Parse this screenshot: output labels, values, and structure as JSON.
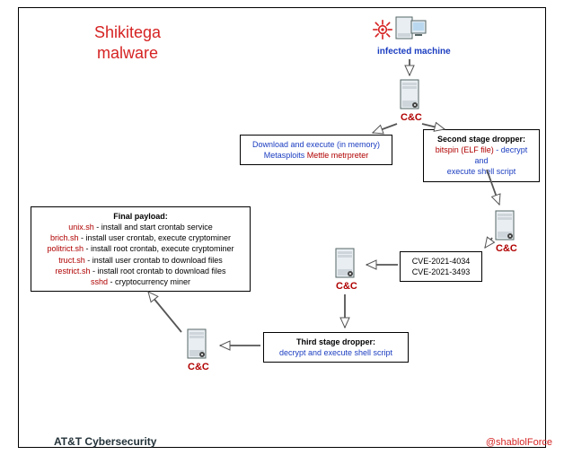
{
  "title_line1": "Shikitega",
  "title_line2": "malware",
  "footer_left": "AT&T Cybersecurity",
  "footer_right": "@shablolForce",
  "labels": {
    "infected": "infected machine",
    "cc": "C&C"
  },
  "boxes": {
    "mettle": {
      "line1": "Download and execute (in memory)",
      "line2a": "Metasploits ",
      "line2b": "Mettle metrpreter"
    },
    "second_stage": {
      "title": "Second stage dropper:",
      "line1a": "bitspin (ELF file)",
      "line1b": " - decrypt and",
      "line2": "execute shell script"
    },
    "cves": {
      "line1": "CVE-2021-4034",
      "line2": "CVE-2021-3493"
    },
    "third_stage": {
      "title": "Third stage dropper:",
      "line1": "decrypt and execute shell script"
    },
    "payload": {
      "title": "Final payload:",
      "l1a": "unix.sh",
      "l1b": " - install and start crontab service",
      "l2a": "brich.sh",
      "l2b": " - install user crontab, execute cryptominer",
      "l3a": "politrict.sh",
      "l3b": " - install root crontab, execute cryptominer",
      "l4a": "truct.sh",
      "l4b": " - install user crontab to download files",
      "l5a": "restrict.sh",
      "l5b": " - install root crontab to download files",
      "l6a": "sshd",
      "l6b": " - cryptocurrency miner"
    }
  },
  "flow": {
    "nodes": [
      {
        "id": "infected",
        "type": "machine",
        "label": "infected machine"
      },
      {
        "id": "cc1",
        "type": "server",
        "label": "C&C"
      },
      {
        "id": "cc2",
        "type": "server",
        "label": "C&C"
      },
      {
        "id": "cc3",
        "type": "server",
        "label": "C&C"
      },
      {
        "id": "cc4",
        "type": "server",
        "label": "C&C"
      },
      {
        "id": "mettle_box",
        "type": "box"
      },
      {
        "id": "second_stage_box",
        "type": "box"
      },
      {
        "id": "cve_box",
        "type": "box"
      },
      {
        "id": "third_stage_box",
        "type": "box"
      },
      {
        "id": "payload_box",
        "type": "box"
      }
    ],
    "edges": [
      [
        "infected",
        "cc1"
      ],
      [
        "cc1",
        "mettle_box"
      ],
      [
        "cc1",
        "second_stage_box"
      ],
      [
        "second_stage_box",
        "cc2"
      ],
      [
        "cc2",
        "cve_box"
      ],
      [
        "cve_box",
        "cc3"
      ],
      [
        "cc3",
        "third_stage_box"
      ],
      [
        "third_stage_box",
        "cc4"
      ],
      [
        "cc4",
        "payload_box"
      ]
    ]
  }
}
